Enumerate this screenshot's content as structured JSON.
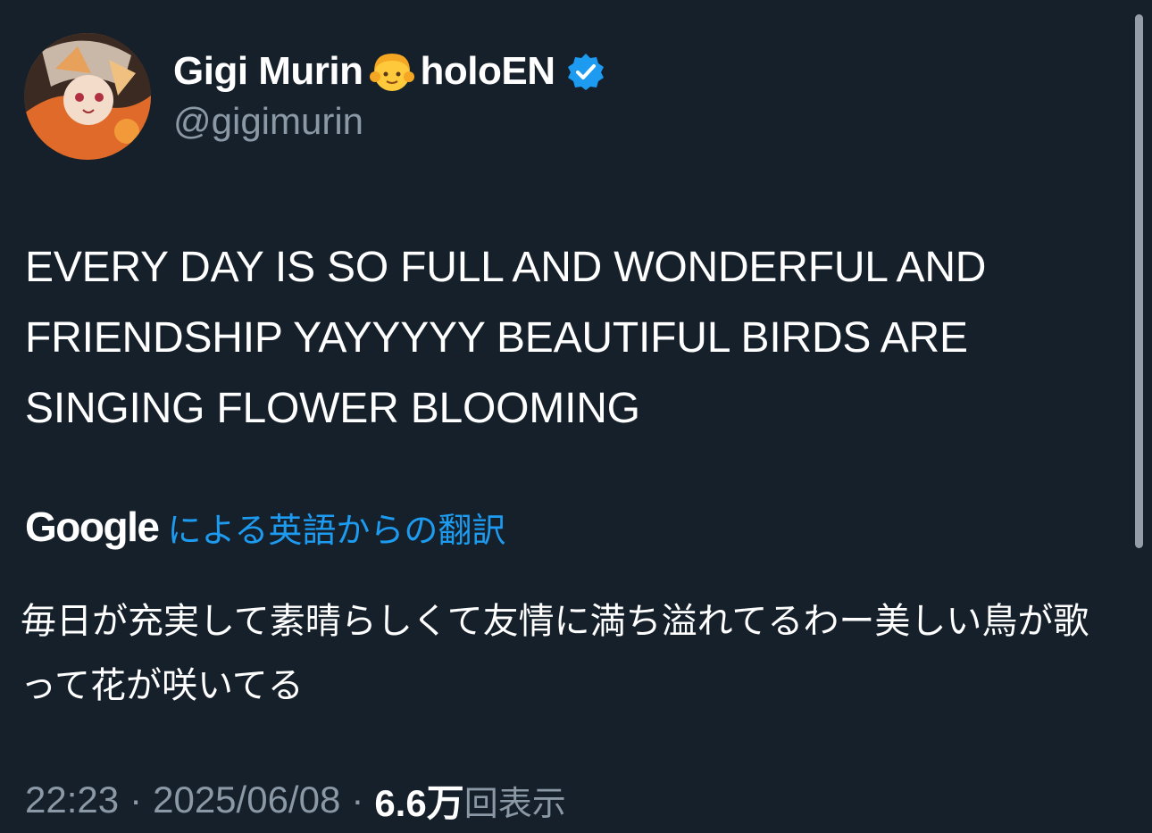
{
  "author": {
    "display_name": "Gigi Murin",
    "name_emoji": "👧",
    "name_suffix": "holoEN",
    "handle": "@gigimurin",
    "verified_color": "#1d9bf0"
  },
  "tweet": {
    "text": "EVERY DAY IS SO FULL AND WONDERFUL AND FRIENDSHIP YAYYYYY BEAUTIFUL BIRDS ARE SINGING FLOWER BLOOMING"
  },
  "translation": {
    "provider": "Google",
    "link_text": "による英語からの翻訳",
    "text": "毎日が充実して素晴らしくて友情に満ち溢れてるわー美しい鳥が歌って花が咲いてる"
  },
  "meta": {
    "time": "22:23",
    "separator": "·",
    "date": "2025/06/08",
    "views_count": "6.6万",
    "views_label": "回表示"
  },
  "colors": {
    "background": "#15202b",
    "text_primary": "#ffffff",
    "text_secondary": "#8b98a5",
    "accent": "#1d9bf0"
  }
}
